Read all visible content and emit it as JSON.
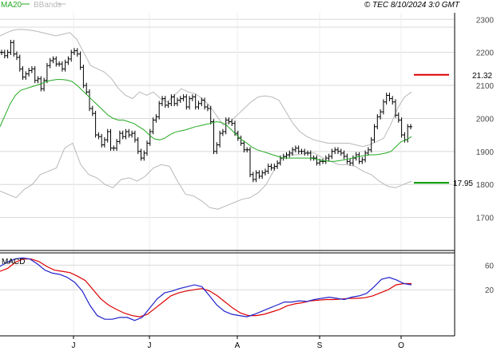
{
  "header": {
    "ma_label": "MA20",
    "bbands_label": "BBands",
    "copyright": "© TEC 8/10/2024 3:0 GMT"
  },
  "colors": {
    "ma20": "#22aa22",
    "bbands": "#b8b8b8",
    "candles": "#000000",
    "resistance": "#dd0000",
    "support": "#009900",
    "macd": "#2222cc",
    "signal": "#dd0000",
    "grid": "#d8d8d8",
    "axis": "#000000"
  },
  "chart_data": [
    {
      "type": "line",
      "title": "",
      "x_labels": [
        "J",
        "J",
        "A",
        "S",
        "O"
      ],
      "y_ticks": [
        1700,
        1800,
        1900,
        2000,
        2100,
        2200,
        2300
      ],
      "y_tick_labels": [
        "1700",
        "1800",
        "1900",
        "2000",
        "2100",
        "2200",
        "2300"
      ],
      "ylim": [
        1600,
        2320
      ],
      "grid": true,
      "legend": "top-left",
      "annotations": [
        {
          "label": "21.32",
          "value": 2132,
          "kind": "resistance"
        },
        {
          "label": "17.95",
          "value": 1805,
          "kind": "support"
        }
      ],
      "series": [
        {
          "name": "MA20",
          "values": [
            1975,
            2010,
            2045,
            2070,
            2085,
            2090,
            2095,
            2100,
            2105,
            2112,
            2115,
            2118,
            2118,
            2116,
            2112,
            2100,
            2085,
            2070,
            2055,
            2040,
            2025,
            2010,
            2000,
            1995,
            1995,
            1990,
            1985,
            1975,
            1965,
            1950,
            1938,
            1935,
            1940,
            1950,
            1958,
            1962,
            1965,
            1970,
            1975,
            1978,
            1982,
            1985,
            1990,
            1988,
            1980,
            1965,
            1950,
            1935,
            1925,
            1913,
            1905,
            1900,
            1895,
            1890,
            1885,
            1880,
            1880,
            1880,
            1880,
            1880,
            1880,
            1878,
            1875,
            1872,
            1870,
            1870,
            1872,
            1875,
            1878,
            1882,
            1885,
            1888,
            1890,
            1890,
            1892,
            1895,
            1900,
            1915,
            1930,
            1935,
            1945
          ]
        },
        {
          "name": "BBands",
          "values": [
            2250,
            2260,
            2268,
            2270,
            2268,
            2265,
            2260,
            2255,
            2250,
            2255,
            2260,
            2240,
            2200,
            2160,
            2150,
            2140,
            2120,
            2090,
            2070,
            2060,
            2080,
            2070,
            2080,
            2060,
            2050,
            2070,
            2090,
            2080,
            2075,
            2060,
            2040,
            2010,
            1980,
            1990,
            2010,
            2030,
            2050,
            2065,
            2068,
            2065,
            2055,
            2020,
            1985,
            1960,
            1945,
            1935,
            1930,
            1925,
            1925,
            1925,
            1925,
            1920,
            1915,
            1920,
            1930,
            1940,
            1980,
            2030,
            2065,
            2080
          ]
        },
        {
          "name": "BBands lower",
          "values": [
            1780,
            1770,
            1760,
            1785,
            1800,
            1830,
            1840,
            1850,
            1910,
            1925,
            1860,
            1830,
            1820,
            1800,
            1790,
            1815,
            1820,
            1810,
            1825,
            1850,
            1860,
            1855,
            1810,
            1770,
            1765,
            1750,
            1730,
            1725,
            1735,
            1745,
            1755,
            1760,
            1775,
            1800,
            1845,
            1880,
            1890,
            1890,
            1895,
            1895,
            1880,
            1870,
            1860,
            1860,
            1855,
            1840,
            1830,
            1810,
            1795,
            1790,
            1800,
            1810
          ]
        },
        {
          "name": "Price",
          "values": [
            2200,
            2190,
            2200,
            2230,
            2195,
            2185,
            2150,
            2125,
            2135,
            2145,
            2150,
            2115,
            2120,
            2090,
            2115,
            2160,
            2175,
            2180,
            2165,
            2165,
            2150,
            2170,
            2180,
            2200,
            2205,
            2195,
            2155,
            2100,
            2080,
            2030,
            2015,
            1950,
            1945,
            1920,
            1935,
            1960,
            1910,
            1910,
            1930,
            1955,
            1945,
            1960,
            1950,
            1955,
            1935,
            1900,
            1880,
            1895,
            1925,
            1960,
            1995,
            2005,
            2045,
            2060,
            2040,
            2045,
            2065,
            2045,
            2055,
            2060,
            2065,
            2035,
            2060,
            2065,
            2035,
            2045,
            2055,
            2035,
            2030,
            1990,
            1900,
            1920,
            1955,
            1960,
            1995,
            1990,
            1985,
            1955,
            1940,
            1925,
            1905,
            1905,
            1830,
            1815,
            1835,
            1825,
            1835,
            1840,
            1855,
            1850,
            1855,
            1865,
            1880,
            1885,
            1890,
            1895,
            1905,
            1910,
            1900,
            1900,
            1895,
            1895,
            1880,
            1880,
            1865,
            1870,
            1870,
            1880,
            1885,
            1900,
            1905,
            1900,
            1895,
            1885,
            1870,
            1865,
            1880,
            1890,
            1870,
            1875,
            1895,
            1905,
            1935,
            1975,
            2005,
            2020,
            2050,
            2070,
            2060,
            2050,
            2010,
            1995,
            1950,
            1935,
            1975,
            1975
          ]
        }
      ]
    },
    {
      "type": "line",
      "title": "MACD",
      "y_ticks": [
        60,
        20
      ],
      "y_tick_labels": [
        "60",
        "20"
      ],
      "ylim": [
        -55,
        80
      ],
      "grid": true,
      "series": [
        {
          "name": "MACD",
          "values": [
            58,
            65,
            70,
            72,
            70,
            62,
            52,
            47,
            45,
            40,
            32,
            18,
            -5,
            -22,
            -28,
            -28,
            -25,
            -25,
            -30,
            -25,
            -10,
            5,
            15,
            18,
            22,
            25,
            28,
            25,
            10,
            -5,
            -15,
            -20,
            -22,
            -24,
            -20,
            -15,
            -10,
            -5,
            0,
            0,
            2,
            1,
            4,
            6,
            8,
            6,
            4,
            8,
            10,
            14,
            25,
            37,
            40,
            36,
            30,
            28
          ]
        },
        {
          "name": "Signal",
          "values": [
            50,
            55,
            65,
            70,
            70,
            66,
            58,
            52,
            50,
            48,
            42,
            35,
            20,
            5,
            -5,
            -12,
            -18,
            -22,
            -24,
            -20,
            -10,
            0,
            10,
            15,
            18,
            20,
            22,
            18,
            10,
            0,
            -10,
            -18,
            -22,
            -22,
            -20,
            -16,
            -12,
            -6,
            -3,
            -1,
            2,
            3,
            4,
            4,
            5,
            6,
            6,
            7,
            10,
            15,
            20,
            28,
            30,
            30
          ]
        }
      ]
    }
  ]
}
